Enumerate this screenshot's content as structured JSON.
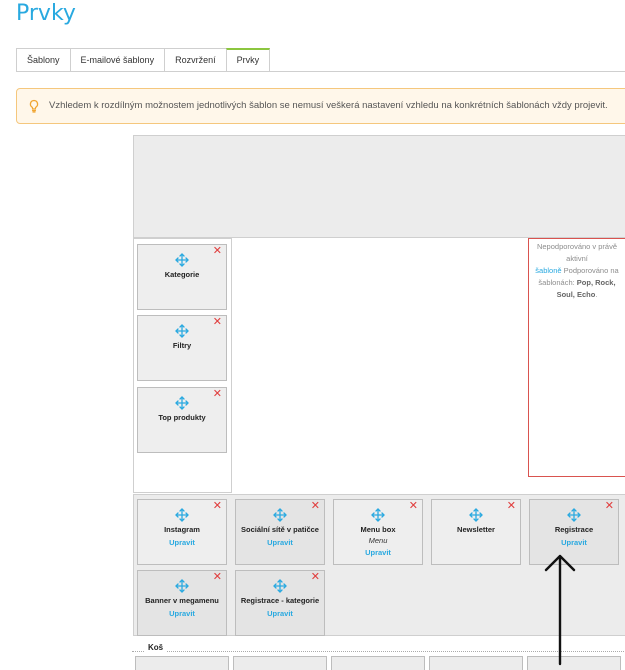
{
  "page": {
    "title": "Prvky"
  },
  "tabs": [
    {
      "label": "Šablony",
      "active": false
    },
    {
      "label": "E-mailové šablony",
      "active": false
    },
    {
      "label": "Rozvržení",
      "active": false
    },
    {
      "label": "Prvky",
      "active": true
    }
  ],
  "notice": {
    "icon": "lightbulb-icon",
    "text": "Vzhledem k rozdílným možnostem jednotlivých šablon se nemusí veškerá nastavení vzhledu na konkrétních šablonách vždy projevit."
  },
  "sidebar_blocks": [
    {
      "name": "Kategorie"
    },
    {
      "name": "Filtry"
    },
    {
      "name": "Top produkty"
    }
  ],
  "right_note": {
    "line1": "Nepodporováno v právě",
    "line2": "aktivní",
    "link": "šabloně",
    "line3": "Podporováno na",
    "line4": "šablonách:",
    "templates": "Pop, Rock, Soul, Echo",
    "end": "."
  },
  "footer_blocks": [
    {
      "name": "Instagram",
      "edit": "Upravit"
    },
    {
      "name": "Sociální sítě v patičce",
      "edit": "Upravit"
    },
    {
      "name": "Menu box",
      "sub": "Menu",
      "edit": "Upravit"
    },
    {
      "name": "Newsletter"
    },
    {
      "name": "Registrace",
      "edit": "Upravit"
    },
    {
      "name": "Banner v megamenu",
      "edit": "Upravit"
    },
    {
      "name": "Registrace - kategorie",
      "edit": "Upravit"
    }
  ],
  "trash": {
    "label": "Koš"
  },
  "icons": {
    "remove": "✕",
    "move": "move-icon"
  },
  "colors": {
    "accent": "#29a9e0",
    "active_tab": "#8cc63f",
    "remove": "#e03b3b",
    "notice_border": "#f5c77d"
  }
}
